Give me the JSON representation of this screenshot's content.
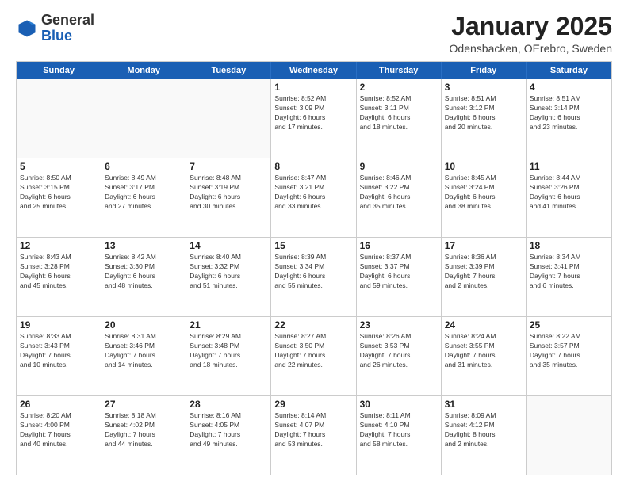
{
  "header": {
    "logo": {
      "line1": "General",
      "line2": "Blue"
    },
    "title": "January 2025",
    "location": "Odensbacken, OErebro, Sweden"
  },
  "days_of_week": [
    "Sunday",
    "Monday",
    "Tuesday",
    "Wednesday",
    "Thursday",
    "Friday",
    "Saturday"
  ],
  "weeks": [
    [
      {
        "day": "",
        "info": ""
      },
      {
        "day": "",
        "info": ""
      },
      {
        "day": "",
        "info": ""
      },
      {
        "day": "1",
        "info": "Sunrise: 8:52 AM\nSunset: 3:09 PM\nDaylight: 6 hours\nand 17 minutes."
      },
      {
        "day": "2",
        "info": "Sunrise: 8:52 AM\nSunset: 3:11 PM\nDaylight: 6 hours\nand 18 minutes."
      },
      {
        "day": "3",
        "info": "Sunrise: 8:51 AM\nSunset: 3:12 PM\nDaylight: 6 hours\nand 20 minutes."
      },
      {
        "day": "4",
        "info": "Sunrise: 8:51 AM\nSunset: 3:14 PM\nDaylight: 6 hours\nand 23 minutes."
      }
    ],
    [
      {
        "day": "5",
        "info": "Sunrise: 8:50 AM\nSunset: 3:15 PM\nDaylight: 6 hours\nand 25 minutes."
      },
      {
        "day": "6",
        "info": "Sunrise: 8:49 AM\nSunset: 3:17 PM\nDaylight: 6 hours\nand 27 minutes."
      },
      {
        "day": "7",
        "info": "Sunrise: 8:48 AM\nSunset: 3:19 PM\nDaylight: 6 hours\nand 30 minutes."
      },
      {
        "day": "8",
        "info": "Sunrise: 8:47 AM\nSunset: 3:21 PM\nDaylight: 6 hours\nand 33 minutes."
      },
      {
        "day": "9",
        "info": "Sunrise: 8:46 AM\nSunset: 3:22 PM\nDaylight: 6 hours\nand 35 minutes."
      },
      {
        "day": "10",
        "info": "Sunrise: 8:45 AM\nSunset: 3:24 PM\nDaylight: 6 hours\nand 38 minutes."
      },
      {
        "day": "11",
        "info": "Sunrise: 8:44 AM\nSunset: 3:26 PM\nDaylight: 6 hours\nand 41 minutes."
      }
    ],
    [
      {
        "day": "12",
        "info": "Sunrise: 8:43 AM\nSunset: 3:28 PM\nDaylight: 6 hours\nand 45 minutes."
      },
      {
        "day": "13",
        "info": "Sunrise: 8:42 AM\nSunset: 3:30 PM\nDaylight: 6 hours\nand 48 minutes."
      },
      {
        "day": "14",
        "info": "Sunrise: 8:40 AM\nSunset: 3:32 PM\nDaylight: 6 hours\nand 51 minutes."
      },
      {
        "day": "15",
        "info": "Sunrise: 8:39 AM\nSunset: 3:34 PM\nDaylight: 6 hours\nand 55 minutes."
      },
      {
        "day": "16",
        "info": "Sunrise: 8:37 AM\nSunset: 3:37 PM\nDaylight: 6 hours\nand 59 minutes."
      },
      {
        "day": "17",
        "info": "Sunrise: 8:36 AM\nSunset: 3:39 PM\nDaylight: 7 hours\nand 2 minutes."
      },
      {
        "day": "18",
        "info": "Sunrise: 8:34 AM\nSunset: 3:41 PM\nDaylight: 7 hours\nand 6 minutes."
      }
    ],
    [
      {
        "day": "19",
        "info": "Sunrise: 8:33 AM\nSunset: 3:43 PM\nDaylight: 7 hours\nand 10 minutes."
      },
      {
        "day": "20",
        "info": "Sunrise: 8:31 AM\nSunset: 3:46 PM\nDaylight: 7 hours\nand 14 minutes."
      },
      {
        "day": "21",
        "info": "Sunrise: 8:29 AM\nSunset: 3:48 PM\nDaylight: 7 hours\nand 18 minutes."
      },
      {
        "day": "22",
        "info": "Sunrise: 8:27 AM\nSunset: 3:50 PM\nDaylight: 7 hours\nand 22 minutes."
      },
      {
        "day": "23",
        "info": "Sunrise: 8:26 AM\nSunset: 3:53 PM\nDaylight: 7 hours\nand 26 minutes."
      },
      {
        "day": "24",
        "info": "Sunrise: 8:24 AM\nSunset: 3:55 PM\nDaylight: 7 hours\nand 31 minutes."
      },
      {
        "day": "25",
        "info": "Sunrise: 8:22 AM\nSunset: 3:57 PM\nDaylight: 7 hours\nand 35 minutes."
      }
    ],
    [
      {
        "day": "26",
        "info": "Sunrise: 8:20 AM\nSunset: 4:00 PM\nDaylight: 7 hours\nand 40 minutes."
      },
      {
        "day": "27",
        "info": "Sunrise: 8:18 AM\nSunset: 4:02 PM\nDaylight: 7 hours\nand 44 minutes."
      },
      {
        "day": "28",
        "info": "Sunrise: 8:16 AM\nSunset: 4:05 PM\nDaylight: 7 hours\nand 49 minutes."
      },
      {
        "day": "29",
        "info": "Sunrise: 8:14 AM\nSunset: 4:07 PM\nDaylight: 7 hours\nand 53 minutes."
      },
      {
        "day": "30",
        "info": "Sunrise: 8:11 AM\nSunset: 4:10 PM\nDaylight: 7 hours\nand 58 minutes."
      },
      {
        "day": "31",
        "info": "Sunrise: 8:09 AM\nSunset: 4:12 PM\nDaylight: 8 hours\nand 2 minutes."
      },
      {
        "day": "",
        "info": ""
      }
    ]
  ]
}
